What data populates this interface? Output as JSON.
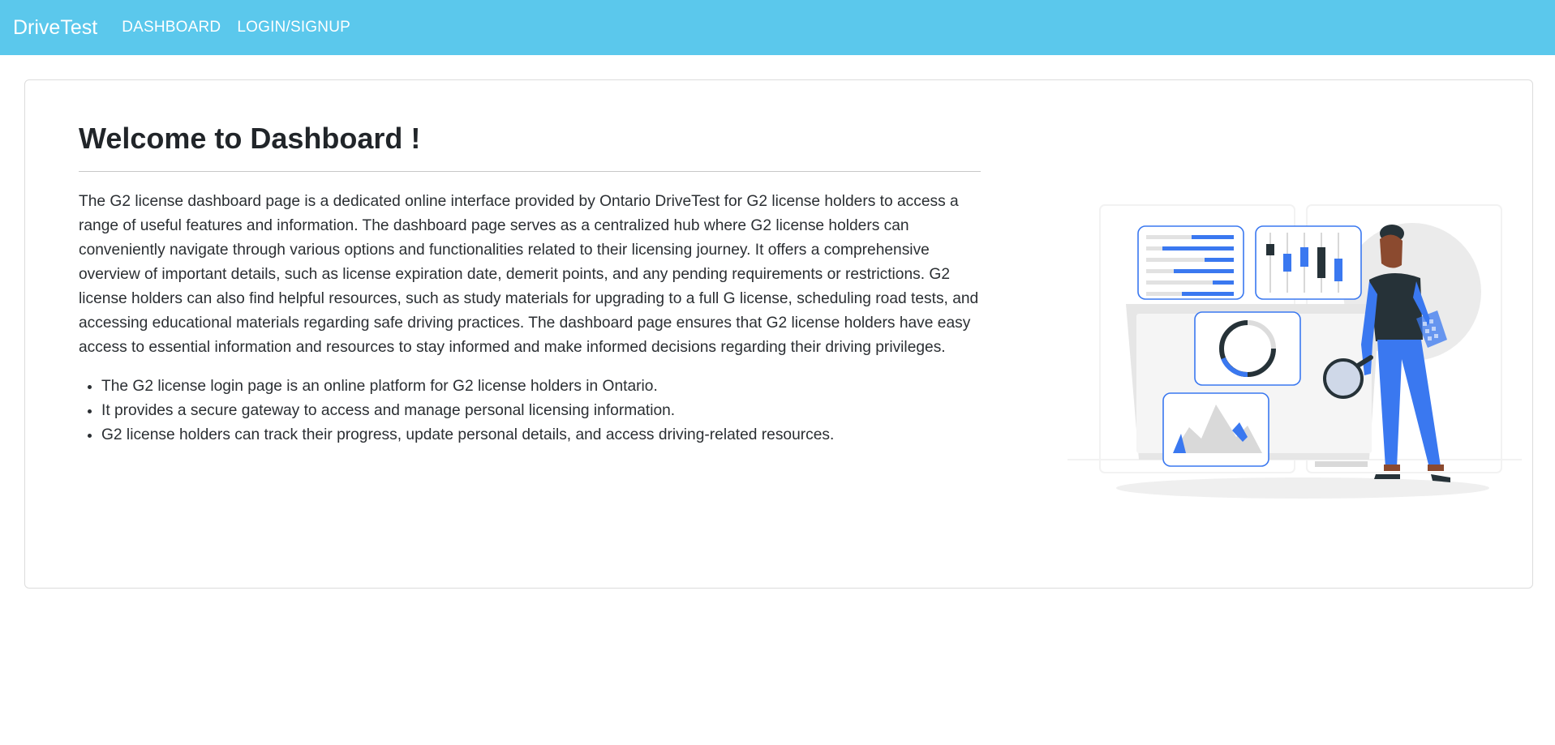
{
  "navbar": {
    "brand": "DriveTest",
    "links": [
      "DASHBOARD",
      "LOGIN/SIGNUP"
    ]
  },
  "main": {
    "title": "Welcome to Dashboard !",
    "paragraph": "The G2 license dashboard page is a dedicated online interface provided by Ontario DriveTest for G2 license holders to access a range of useful features and information. The dashboard page serves as a centralized hub where G2 license holders can conveniently navigate through various options and functionalities related to their licensing journey. It offers a comprehensive overview of important details, such as license expiration date, demerit points, and any pending requirements or restrictions. G2 license holders can also find helpful resources, such as study materials for upgrading to a full G license, scheduling road tests, and accessing educational materials regarding safe driving practices. The dashboard page ensures that G2 license holders have easy access to essential information and resources to stay informed and make informed decisions regarding their driving privileges.",
    "bullets": [
      "The G2 license login page is an online platform for G2 license holders in Ontario.",
      "It provides a secure gateway to access and manage personal licensing information.",
      "G2 license holders can track their progress, update personal details, and access driving-related resources."
    ]
  },
  "colors": {
    "navbar": "#5bc8ec",
    "accent": "#3a78f0",
    "dark": "#263238"
  }
}
